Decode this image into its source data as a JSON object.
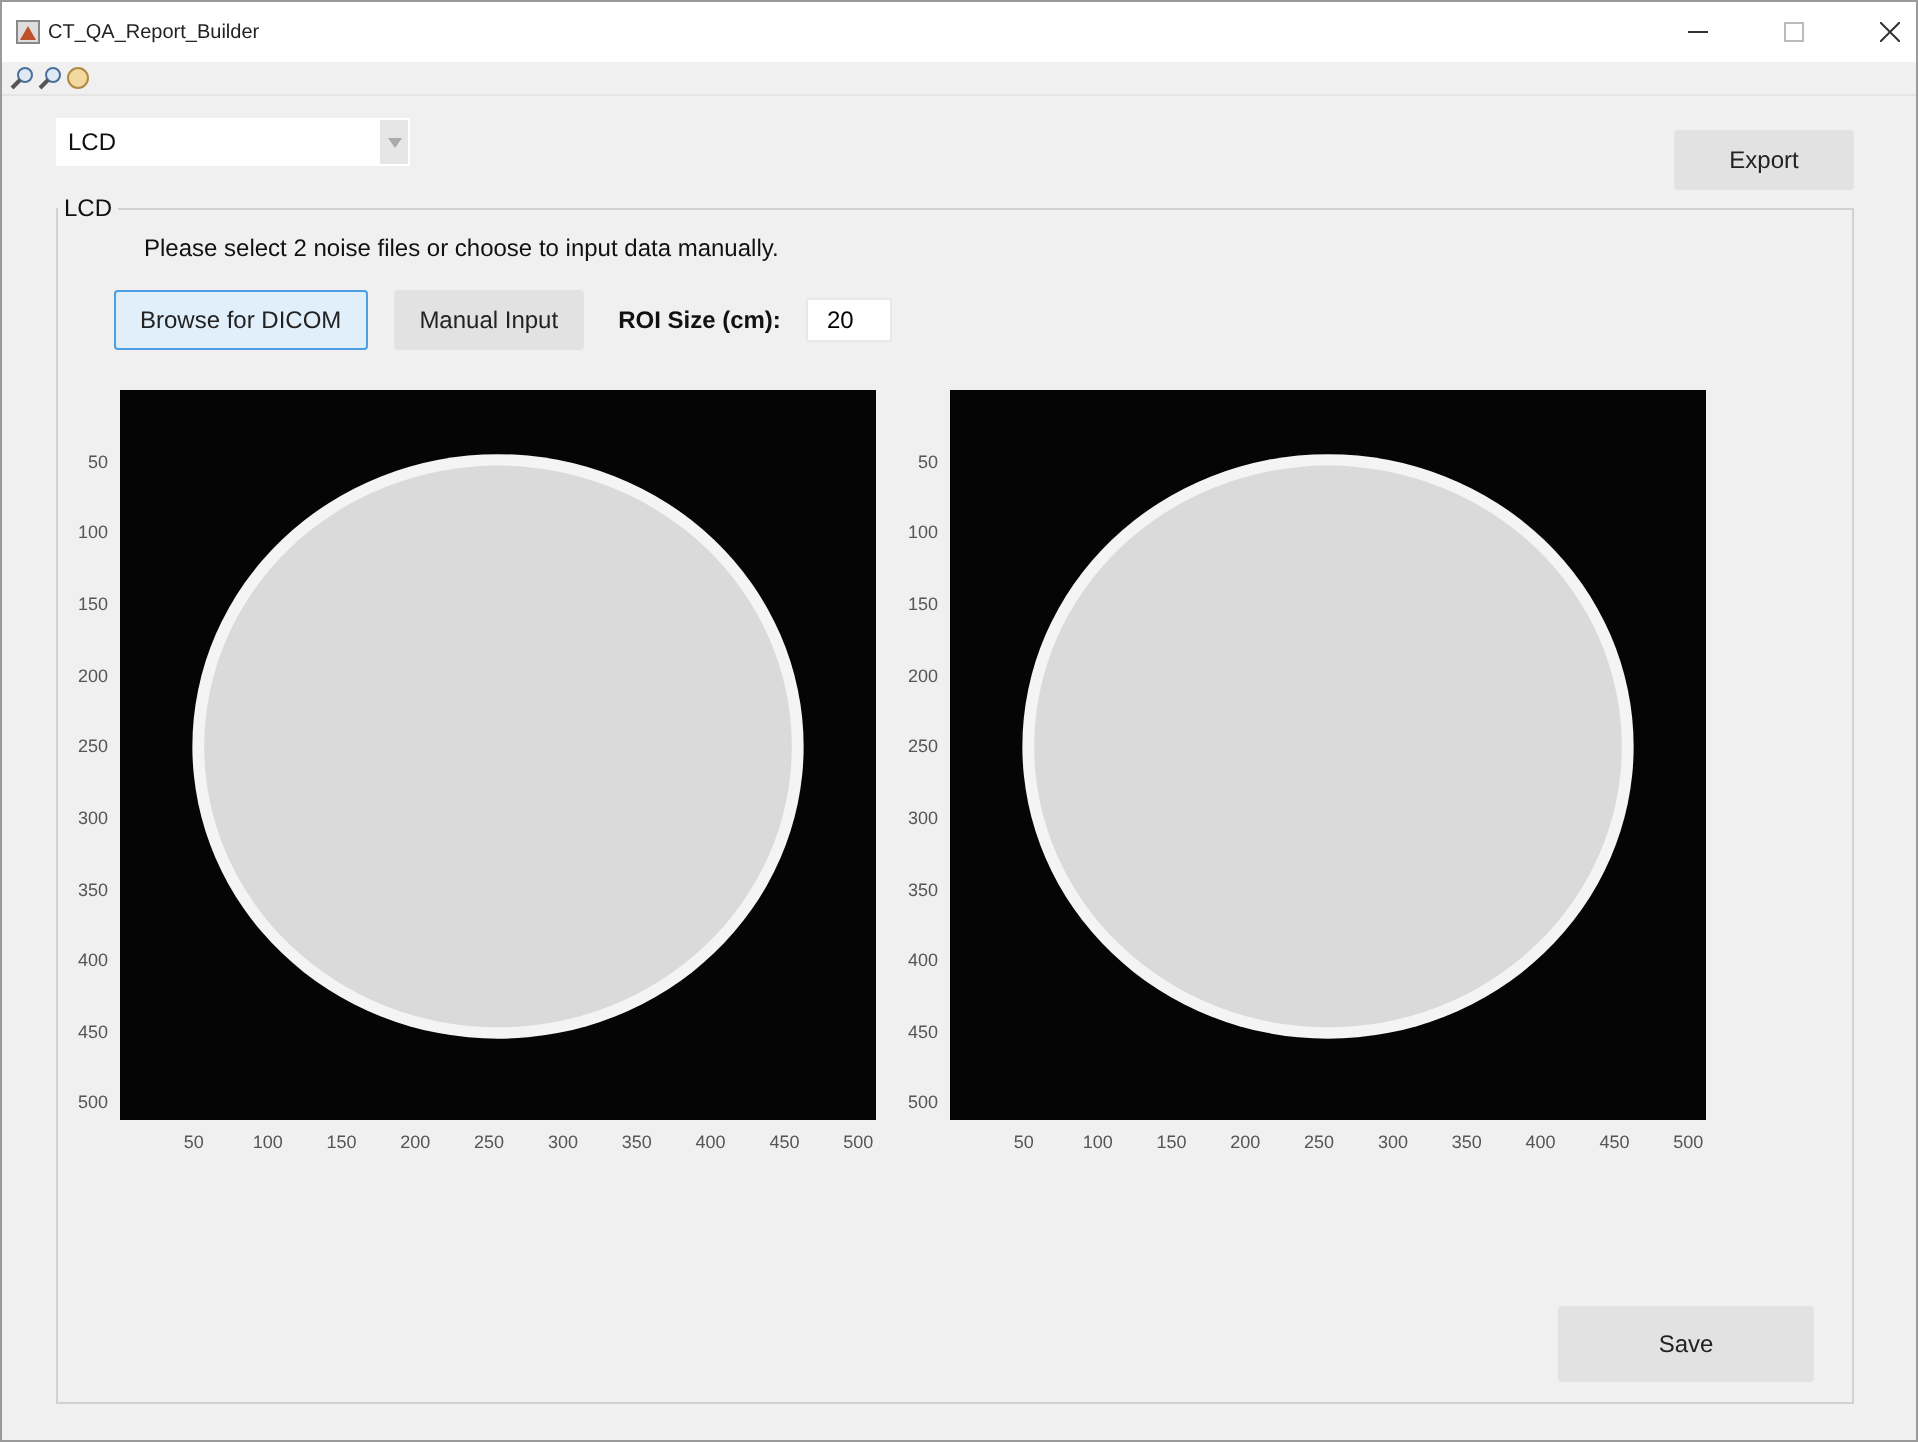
{
  "window": {
    "title": "CT_QA_Report_Builder"
  },
  "mode_dropdown": {
    "value": "LCD"
  },
  "export_button": {
    "label": "Export"
  },
  "panel": {
    "title": "LCD",
    "instruction": "Please select 2 noise files or choose to input data manually.",
    "buttons": [
      {
        "label": "Browse for DICOM",
        "focused": true
      },
      {
        "label": "Manual Input",
        "focused": false
      }
    ],
    "roi_size": {
      "label": "ROI Size (cm):",
      "value": "20"
    },
    "images": [
      {
        "y_ticks": [
          "50",
          "100",
          "150",
          "200",
          "250",
          "300",
          "350",
          "400",
          "450",
          "500"
        ],
        "x_ticks": [
          "50",
          "100",
          "150",
          "200",
          "250",
          "300",
          "350",
          "400",
          "450",
          "500"
        ]
      },
      {
        "y_ticks": [
          "50",
          "100",
          "150",
          "200",
          "250",
          "300",
          "350",
          "400",
          "450",
          "500"
        ],
        "x_ticks": [
          "50",
          "100",
          "150",
          "200",
          "250",
          "300",
          "350",
          "400",
          "450",
          "500"
        ]
      }
    ],
    "save_button": {
      "label": "Save"
    }
  }
}
